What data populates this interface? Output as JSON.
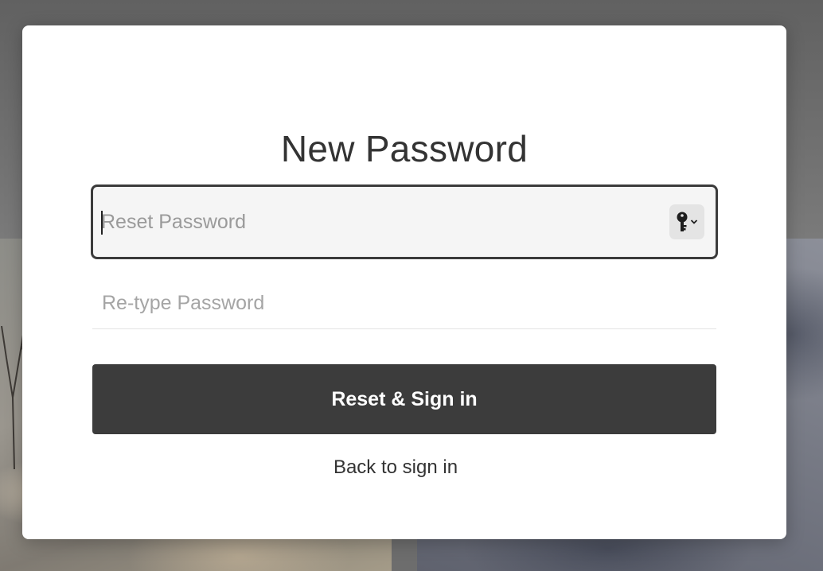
{
  "modal": {
    "title": "New Password",
    "password_field": {
      "value": "",
      "placeholder": "Reset Password"
    },
    "retype_field": {
      "value": "",
      "placeholder": "Re-type Password"
    },
    "password_manager_icon": "key-icon",
    "submit_label": "Reset & Sign in",
    "back_link_label": "Back to sign in"
  },
  "colors": {
    "button_bg": "#3c3c3c",
    "title_text": "#333333",
    "placeholder_text": "#9a9a9a",
    "active_field_border": "#3b3b3b"
  }
}
